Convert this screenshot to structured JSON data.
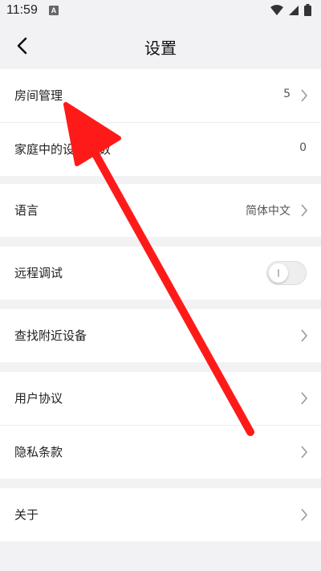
{
  "status": {
    "time": "11:59",
    "notif_letter": "A"
  },
  "header": {
    "title": "设置"
  },
  "rows": {
    "room": {
      "label": "房间管理",
      "value": "5"
    },
    "devices": {
      "label": "家庭中的设备总数",
      "value": "0"
    },
    "language": {
      "label": "语言",
      "value": "简体中文"
    },
    "debug": {
      "label": "远程调试",
      "toggle_on": false
    },
    "nearby": {
      "label": "查找附近设备"
    },
    "agreement": {
      "label": "用户协议"
    },
    "privacy": {
      "label": "隐私条款"
    },
    "about": {
      "label": "关于"
    }
  },
  "colors": {
    "annotation_arrow": "#ff1a1a",
    "background": "#f2f2f4"
  }
}
